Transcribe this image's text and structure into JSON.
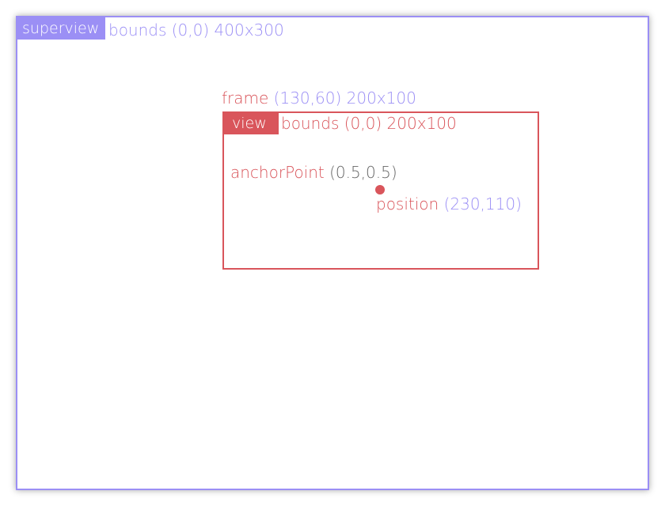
{
  "superview": {
    "tag": "superview",
    "bounds_label": "bounds (0,0) 400x300"
  },
  "frame": {
    "word": "frame",
    "value": "(130,60) 200x100"
  },
  "view": {
    "tag": "view",
    "bounds_label": "bounds (0,0) 200x100"
  },
  "anchor": {
    "word": "anchorPoint",
    "value": "(0.5,0.5)"
  },
  "position": {
    "word": "position",
    "value": "(230,110)"
  },
  "colors": {
    "superview": "#9b8ff5",
    "view": "#d9555b",
    "neutral": "#666666"
  }
}
